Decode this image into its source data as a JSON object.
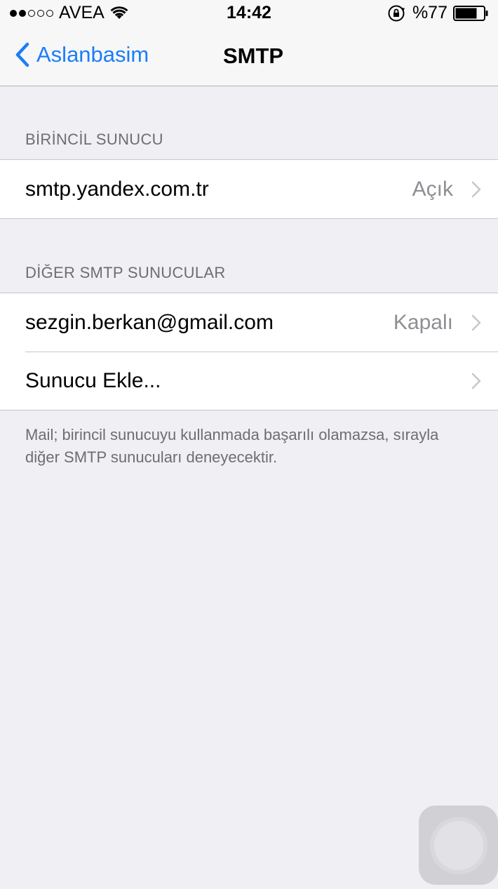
{
  "status_bar": {
    "carrier": "AVEA",
    "time": "14:42",
    "battery_percent": "%77",
    "signal_bars_filled": 2,
    "signal_bars_total": 5,
    "battery_level": 0.77
  },
  "nav": {
    "back_label": "Aslanbasim",
    "title": "SMTP"
  },
  "primary_section": {
    "header": "BİRİNCİL SUNUCU",
    "rows": [
      {
        "label": "smtp.yandex.com.tr",
        "detail": "Açık"
      }
    ]
  },
  "other_section": {
    "header": "DİĞER SMTP SUNUCULAR",
    "rows": [
      {
        "label": "sezgin.berkan@gmail.com",
        "detail": "Kapalı"
      },
      {
        "label": "Sunucu Ekle...",
        "detail": ""
      }
    ]
  },
  "footer_note": "Mail; birincil sunucuyu kullanmada başarılı olamazsa, sırayla diğer SMTP sunucuları deneyecektir.",
  "colors": {
    "accent": "#1a7ef7",
    "background": "#efeff4",
    "secondary_text": "#6d6d72",
    "detail_text": "#8e8e93"
  },
  "icons": [
    "wifi-icon",
    "orientation-lock-icon",
    "battery-icon",
    "back-chevron-icon",
    "chevron-right-icon",
    "assistive-touch-icon"
  ]
}
